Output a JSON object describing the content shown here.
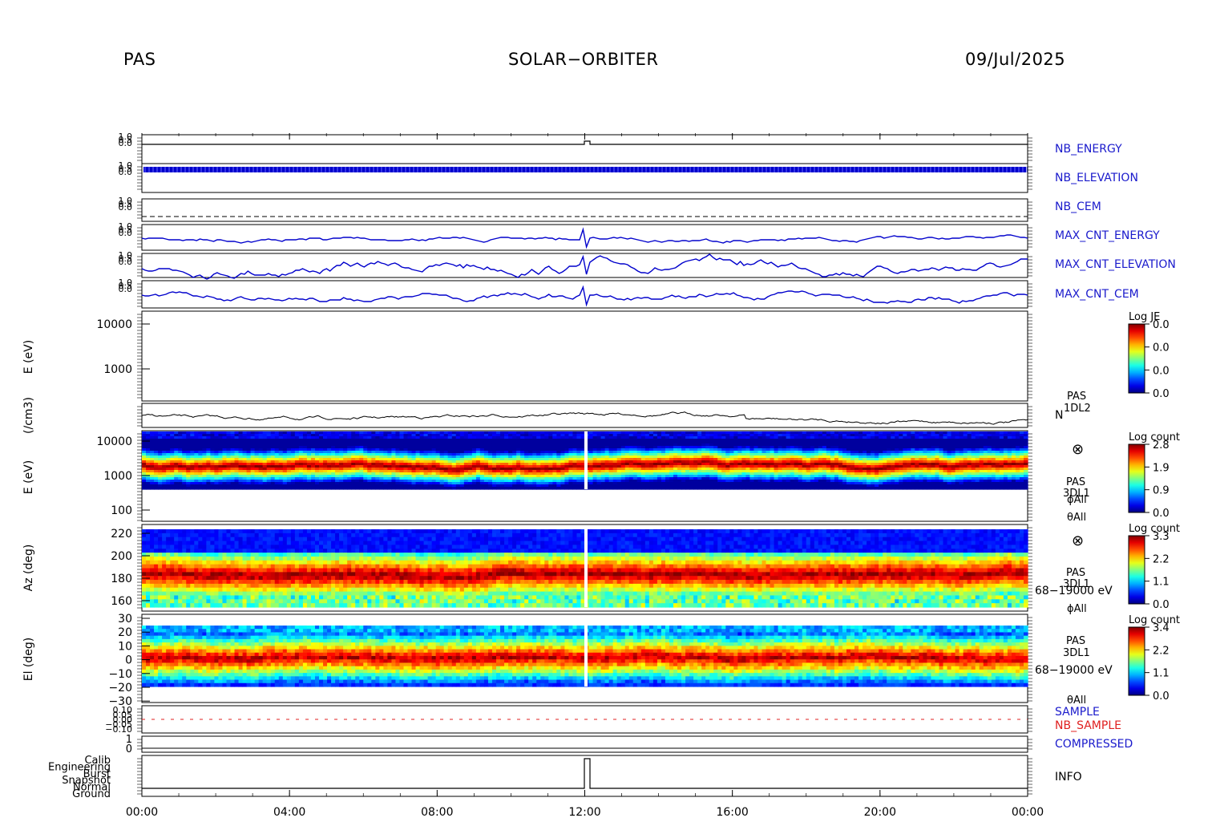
{
  "header": {
    "instrument": "PAS",
    "mission": "SOLAR−ORBITER",
    "date": "09/Jul/2025"
  },
  "colors": {
    "trace_blue": "#0000cc",
    "label_blue": "#1a1acc",
    "label_red": "#e02020",
    "axis": "#000000"
  },
  "chart_data": [
    {
      "type": "line",
      "panel": "status",
      "x_ticks": [
        "00:00",
        "04:00",
        "08:00",
        "12:00",
        "16:00",
        "20:00",
        "00:00"
      ],
      "series": [
        {
          "name": "NB_ENERGY"
        },
        {
          "name": "NB_ELEVATION"
        },
        {
          "name": "NB_CEM"
        },
        {
          "name": "MAX_CNT_ENERGY"
        },
        {
          "name": "MAX_CNT_ELEVATION"
        },
        {
          "name": "MAX_CNT_CEM"
        }
      ]
    },
    {
      "type": "heatmap",
      "panel": "1DL2 energy",
      "ylabel": "E (eV)",
      "yscale": "log",
      "y_ticks": [
        "10000",
        "1000"
      ],
      "colorbar": {
        "title": "Log JE",
        "ticks": [
          "0.0",
          "0.0",
          "0.0",
          "0.0"
        ]
      }
    },
    {
      "type": "line",
      "panel": "density",
      "ylabel": "(/cm3)",
      "series_label": "N",
      "instrument_label": [
        "PAS",
        "1DL2"
      ]
    },
    {
      "type": "heatmap",
      "panel": "3DL1 energy",
      "ylabel": "E (eV)",
      "yscale": "log",
      "y_ticks": [
        "10000",
        "1000",
        "100"
      ],
      "instrument_label": [
        "PAS",
        "3DL1",
        "ϕAll",
        "θAll"
      ],
      "colorbar": {
        "title": "Log count",
        "ticks": [
          "2.8",
          "1.9",
          "0.9",
          "0.0"
        ]
      }
    },
    {
      "type": "heatmap",
      "panel": "azimuth",
      "ylabel": "Az (deg)",
      "y_ticks": [
        "220",
        "200",
        "180",
        "160"
      ],
      "instrument_label": [
        "PAS",
        "3DL1",
        "68−19000 eV",
        "ϕAll"
      ],
      "colorbar": {
        "title": "Log count",
        "ticks": [
          "3.3",
          "2.2",
          "1.1",
          "0.0"
        ]
      }
    },
    {
      "type": "heatmap",
      "panel": "elevation",
      "ylabel": "El (deg)",
      "y_ticks": [
        "30",
        "20",
        "10",
        "0",
        "−10",
        "−20",
        "−30"
      ],
      "instrument_label": [
        "PAS",
        "3DL1",
        "68−19000 eV",
        "θAll"
      ],
      "colorbar": {
        "title": "Log count",
        "ticks": [
          "3.4",
          "2.2",
          "1.1",
          "0.0"
        ]
      }
    },
    {
      "type": "line",
      "panel": "mode",
      "series": [
        {
          "name": "SAMPLE"
        },
        {
          "name": "NB_SAMPLE"
        },
        {
          "name": "COMPRESSED"
        },
        {
          "name": "INFO"
        }
      ],
      "info_levels": [
        "Calib",
        "Engineering",
        "Burst",
        "Snapshot",
        "Normal",
        "Ground"
      ],
      "compressed_ticks": [
        "1",
        "0"
      ]
    }
  ]
}
